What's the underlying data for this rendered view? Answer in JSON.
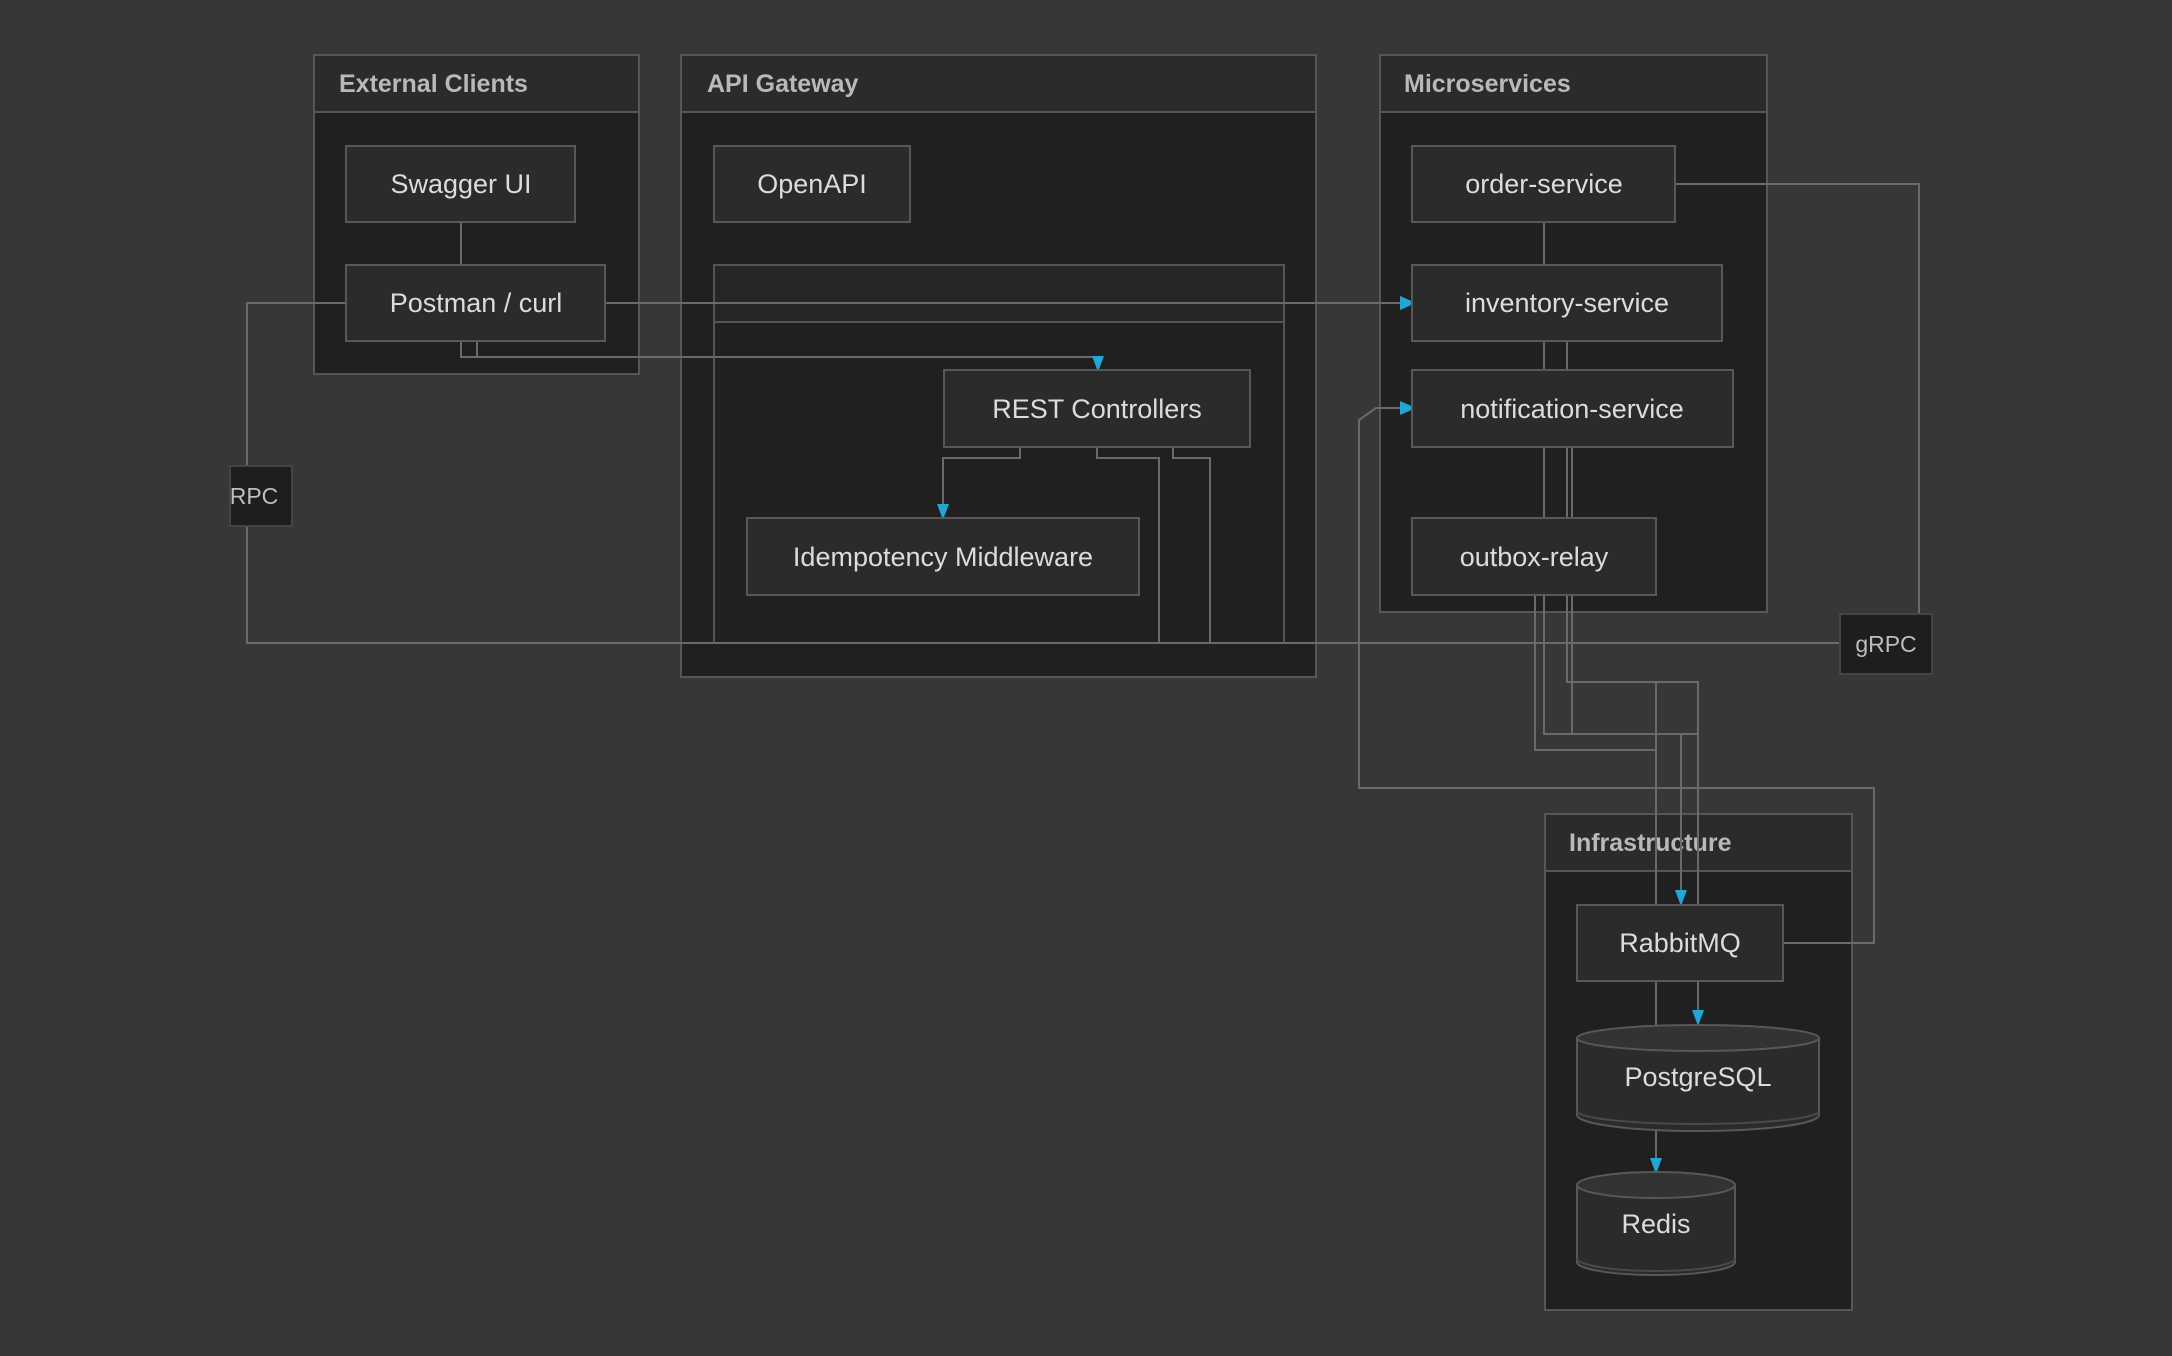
{
  "groups": {
    "external_clients": "External Clients",
    "api_gateway": "API Gateway",
    "microservices": "Microservices",
    "infrastructure": "Infrastructure"
  },
  "nodes": {
    "swagger_ui": "Swagger UI",
    "postman_curl": "Postman / curl",
    "openapi": "OpenAPI",
    "rest_controllers": "REST Controllers",
    "idempotency_middleware": "Idempotency Middleware",
    "order_service": "order-service",
    "inventory_service": "inventory-service",
    "notification_service": "notification-service",
    "outbox_relay": "outbox-relay",
    "rabbitmq": "RabbitMQ",
    "postgresql": "PostgreSQL",
    "redis": "Redis"
  },
  "edge_labels": {
    "rpc": "RPC",
    "grpc": "gRPC"
  },
  "colors": {
    "background": "#373737",
    "arrow": "#22a6d6"
  }
}
